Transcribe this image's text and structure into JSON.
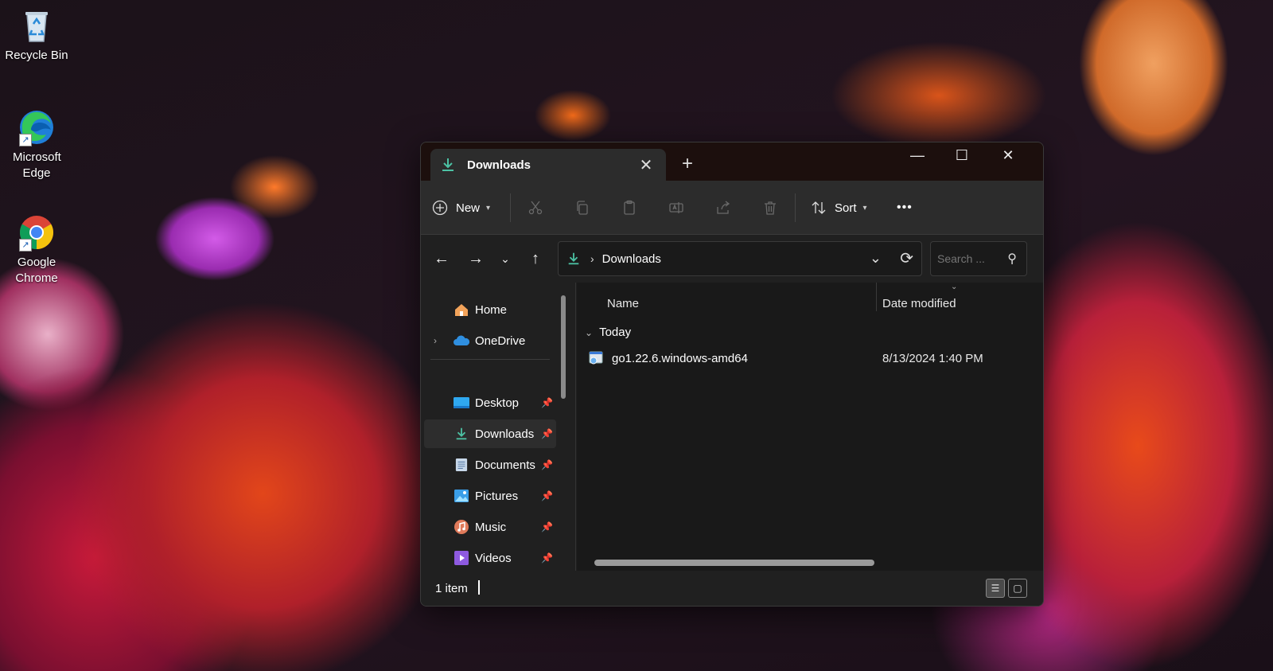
{
  "desktop": {
    "icons": [
      {
        "label": "Recycle Bin",
        "icon": "recycle-bin-icon"
      },
      {
        "label": "Microsoft Edge",
        "icon": "edge-icon"
      },
      {
        "label": "Google Chrome",
        "icon": "chrome-icon"
      }
    ]
  },
  "window": {
    "tab_title": "Downloads",
    "tab_close": "✕",
    "new_tab": "+",
    "controls": {
      "minimize": "—",
      "maximize": "☐",
      "close": "✕"
    },
    "toolbar": {
      "new_label": "New",
      "sort_label": "Sort",
      "more": "•••"
    },
    "address": {
      "chevron": "›",
      "path": "Downloads",
      "search_placeholder": "Search ..."
    },
    "nav": {
      "items": [
        {
          "label": "Home",
          "icon": "home-icon"
        },
        {
          "label": "OneDrive",
          "icon": "cloud-icon"
        },
        {
          "label": "Desktop",
          "icon": "desktop-folder-icon"
        },
        {
          "label": "Downloads",
          "icon": "download-icon"
        },
        {
          "label": "Documents",
          "icon": "documents-icon"
        },
        {
          "label": "Pictures",
          "icon": "pictures-icon"
        },
        {
          "label": "Music",
          "icon": "music-icon"
        },
        {
          "label": "Videos",
          "icon": "videos-icon"
        }
      ]
    },
    "content": {
      "columns": {
        "name": "Name",
        "date": "Date modified"
      },
      "group": "Today",
      "files": [
        {
          "name": "go1.22.6.windows-amd64",
          "date": "8/13/2024 1:40 PM",
          "icon": "installer-icon"
        }
      ]
    },
    "status": {
      "count": "1 item"
    }
  },
  "colors": {
    "accent": "#4cc2a4",
    "window_bg": "#202020",
    "titlebar": "#1c0f0d"
  }
}
